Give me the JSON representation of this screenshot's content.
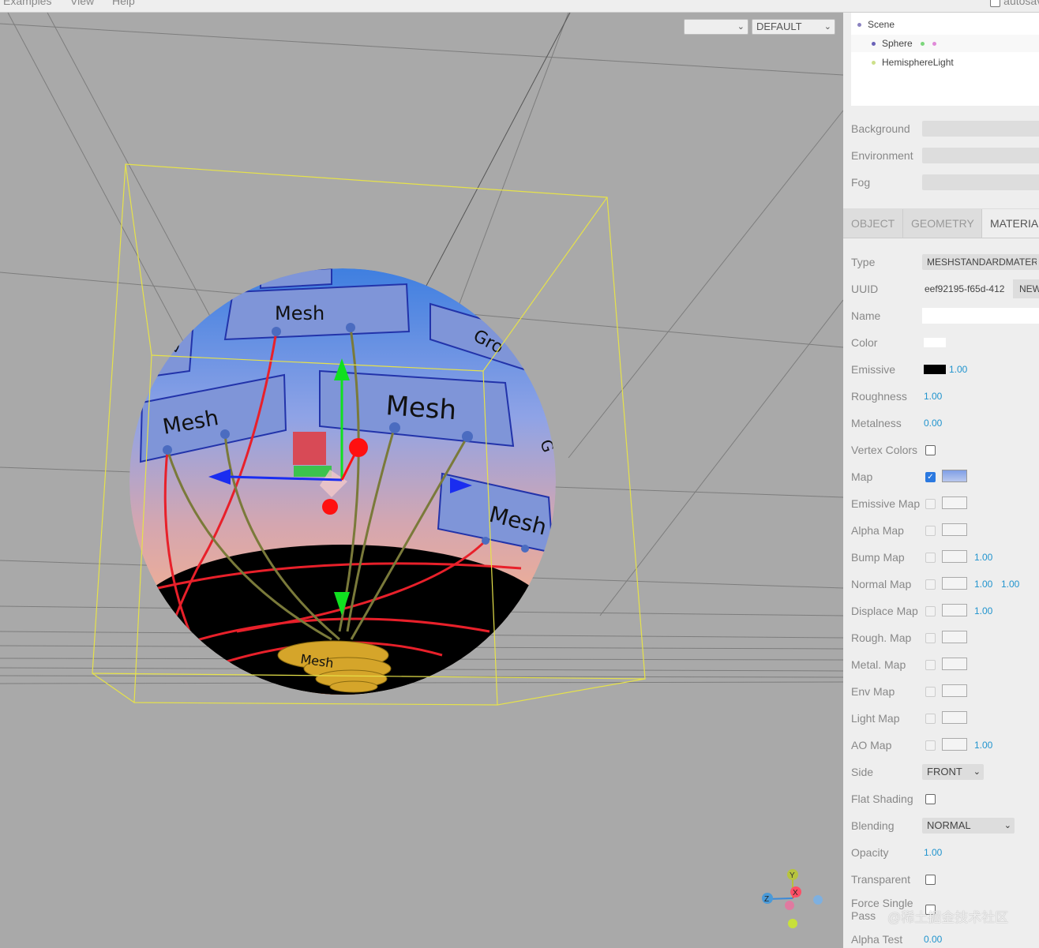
{
  "menubar": {
    "items": [
      "Examples",
      "View",
      "Help"
    ],
    "autosave_label": "autosave"
  },
  "viewport": {
    "camera_select": "",
    "shading_select": "DEFAULT",
    "sphere_labels": [
      "Mesh",
      "Mesh",
      "Mesh",
      "Mesh",
      "Gro",
      "D",
      "G",
      "Mesh"
    ],
    "gizmo": {
      "y": "Y",
      "x": "X",
      "z": "Z"
    }
  },
  "outliner": {
    "items": [
      {
        "label": "Scene",
        "dot": "#8a82c0"
      },
      {
        "label": "Sphere",
        "dot": "#6a62b8"
      },
      {
        "label": "HemisphereLight",
        "dot": "#cde08a"
      }
    ]
  },
  "scene_props": [
    {
      "label": "Background",
      "value": ""
    },
    {
      "label": "Environment",
      "value": ""
    },
    {
      "label": "Fog",
      "value": ""
    }
  ],
  "tabs": [
    "OBJECT",
    "GEOMETRY",
    "MATERIAL"
  ],
  "material": {
    "type_label": "Type",
    "type_value": "MESHSTANDARDMATERIAL",
    "uuid_label": "UUID",
    "uuid_value": "eef92195-f65d-412",
    "new_label": "NEW",
    "name_label": "Name",
    "name_value": "",
    "color_label": "Color",
    "color": "#ffffff",
    "emissive_label": "Emissive",
    "emissive_color": "#000000",
    "emissive_intensity": "1.00",
    "roughness_label": "Roughness",
    "roughness": "1.00",
    "metalness_label": "Metalness",
    "metalness": "0.00",
    "vertex_colors_label": "Vertex Colors",
    "maps": [
      {
        "label": "Map",
        "checked": true,
        "values": []
      },
      {
        "label": "Emissive Map",
        "values": []
      },
      {
        "label": "Alpha Map",
        "values": []
      },
      {
        "label": "Bump Map",
        "values": [
          "1.00"
        ]
      },
      {
        "label": "Normal Map",
        "values": [
          "1.00",
          "1.00"
        ]
      },
      {
        "label": "Displace Map",
        "values": [
          "1.00"
        ]
      },
      {
        "label": "Rough. Map",
        "values": []
      },
      {
        "label": "Metal. Map",
        "values": []
      },
      {
        "label": "Env Map",
        "values": []
      },
      {
        "label": "Light Map",
        "values": []
      },
      {
        "label": "AO Map",
        "values": [
          "1.00"
        ]
      }
    ],
    "side_label": "Side",
    "side_value": "FRONT",
    "flat_shading_label": "Flat Shading",
    "blending_label": "Blending",
    "blending_value": "NORMAL",
    "opacity_label": "Opacity",
    "opacity": "1.00",
    "transparent_label": "Transparent",
    "force_single_pass_label_1": "Force Single",
    "force_single_pass_label_2": "Pass",
    "alpha_test_label": "Alpha Test",
    "alpha_test": "0.00"
  },
  "watermark": "@稀土掘金技术社区"
}
